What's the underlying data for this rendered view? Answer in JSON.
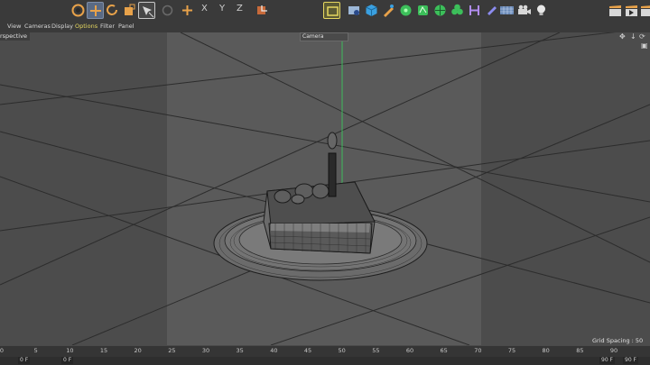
{
  "toolbar": {
    "axis_x": "X",
    "axis_y": "Y",
    "axis_z": "Z",
    "icons": [
      "undo-icon",
      "move-icon",
      "rotate-icon",
      "scale-icon",
      "live-select-icon",
      "render-region-icon",
      "add-object-icon",
      "cube-icon",
      "pen-icon",
      "generator-icon",
      "deformer-icon",
      "environment-icon",
      "camera-icon",
      "light-icon"
    ]
  },
  "menu": {
    "items": [
      "View",
      "Cameras",
      "Display",
      "Options",
      "Filter",
      "Panel"
    ],
    "active": "Options"
  },
  "viewport": {
    "label": "rspective",
    "camera": "Camera",
    "grid_spacing": "Grid Spacing : 50 cm"
  },
  "timeline": {
    "ticks": [
      "0",
      "5",
      "10",
      "15",
      "20",
      "25",
      "30",
      "35",
      "40",
      "45",
      "50",
      "55",
      "60",
      "65",
      "70",
      "75",
      "80",
      "85",
      "90"
    ],
    "start_field": "0 F",
    "current_field": "0 F",
    "end_field": "90 F",
    "end_field2": "90 F"
  },
  "colors": {
    "accent": "#e8a24a",
    "active_menu": "#e6d860",
    "y_axis": "#3dbb5c"
  }
}
